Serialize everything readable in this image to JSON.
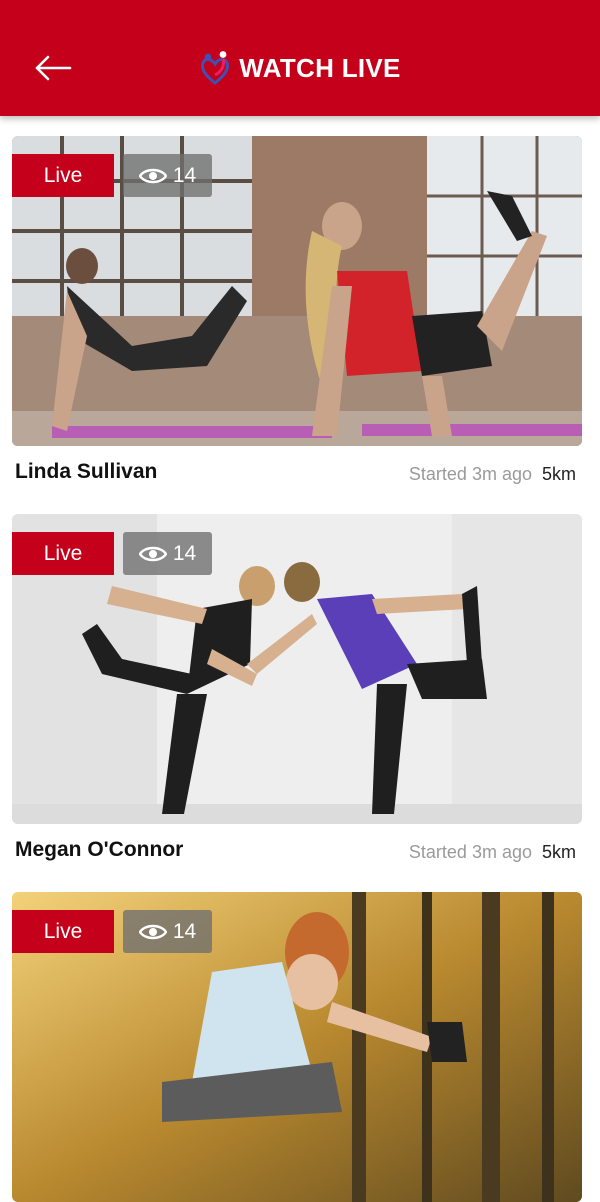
{
  "header": {
    "title": "WATCH LIVE",
    "background": "#c4001a",
    "back_icon": "arrow-left-icon",
    "logo_icon": "heart-couple-logo-icon"
  },
  "streams": [
    {
      "badge": "Live",
      "viewers": "14",
      "name": "Linda Sullivan",
      "started": "Started 3m ago",
      "distance": "5km"
    },
    {
      "badge": "Live",
      "viewers": "14",
      "name": "Megan O'Connor",
      "started": "Started 3m ago",
      "distance": "5km"
    },
    {
      "badge": "Live",
      "viewers": "14",
      "name": "",
      "started": "",
      "distance": ""
    }
  ],
  "colors": {
    "accent": "#c4001a",
    "muted_text": "#9a9a9a"
  }
}
